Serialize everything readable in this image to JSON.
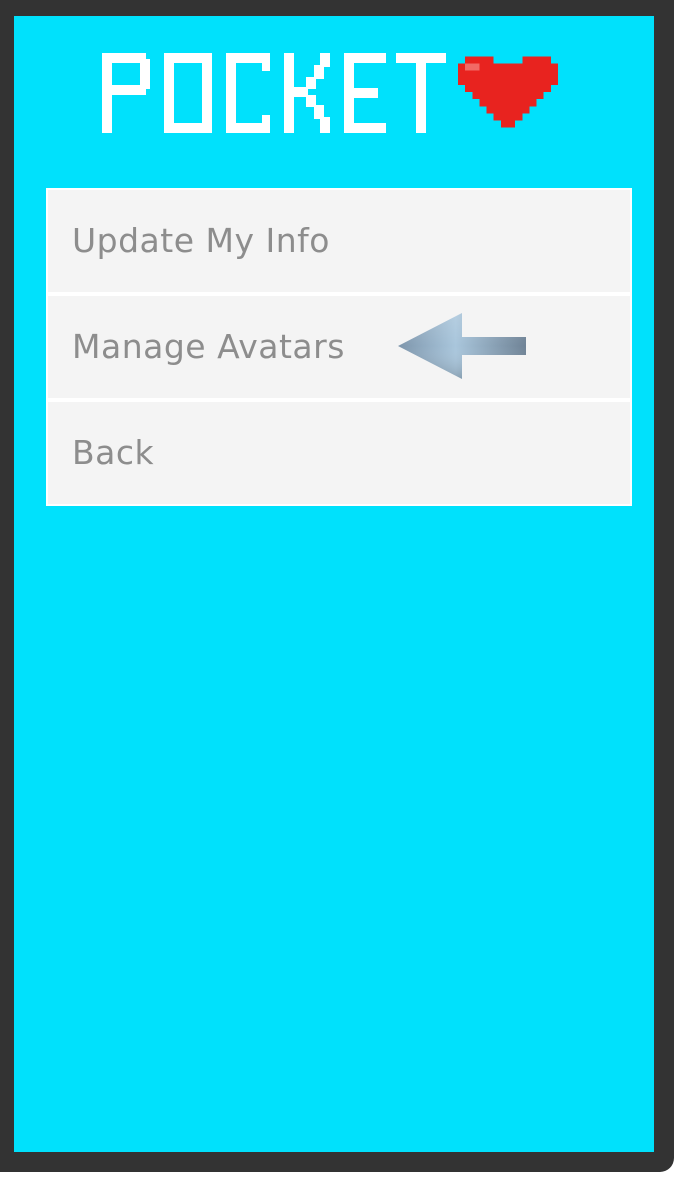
{
  "app": {
    "logo_text": "POCKET",
    "logo_heart_icon": "heart-icon",
    "colors": {
      "background": "#00e1fc",
      "frame": "#333333",
      "menu_item_bg": "#f4f4f4",
      "menu_text": "#8d8d8d",
      "heart": "#e8231f",
      "logo_text": "#ffffff"
    }
  },
  "menu": {
    "items": [
      {
        "label": "Update My Info"
      },
      {
        "label": "Manage Avatars",
        "pointer_icon": "arrow-left-icon"
      },
      {
        "label": "Back"
      }
    ]
  }
}
